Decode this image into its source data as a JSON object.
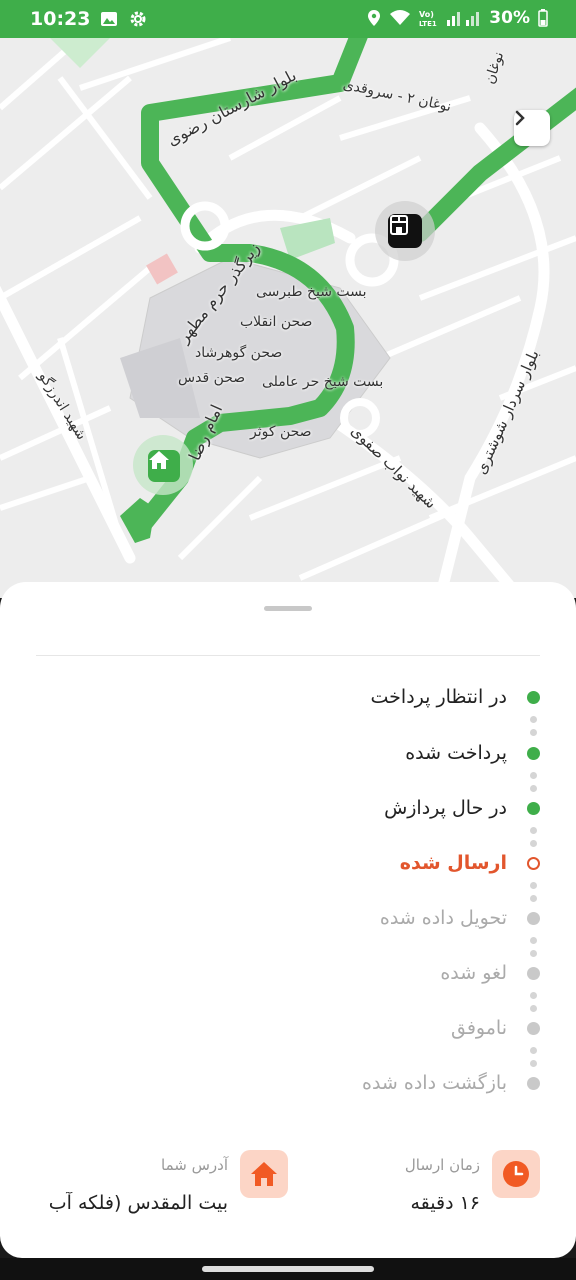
{
  "status_bar": {
    "time": "10:23",
    "battery": "30%",
    "icons": [
      "image-icon",
      "settings-icon",
      "location-icon",
      "wifi-icon",
      "volte-icon",
      "signal-icon",
      "battery-icon"
    ]
  },
  "map": {
    "labels": {
      "boulevard_sharestan": "بلوار شارستان رضوی",
      "noghan_sarvghadi": "نوغان ۲ - سروقدی",
      "noghan": "نوغان",
      "zirgozar": "زیرگذر حرم مطهر",
      "bast_tabarsi": "بست شیخ طبرسی",
      "sahn_enghelab": "صحن انقلاب",
      "sahn_goharshad": "صحن گوهرشاد",
      "sahn_ghods": "صحن قدس",
      "bast_horr": "بست شیخ حر عاملی",
      "sahn_kowsar": "صحن کوثر",
      "imam_reza": "امام رضا",
      "shahid_andarzgoo": "شهید اندرزگو",
      "navvab_safavi": "شهید نواب صفوی",
      "sardar_shooshtari": "بلوار سردار شوشتری"
    },
    "route_color": "#4cb557",
    "markers": [
      "home-marker-icon",
      "store-marker-icon"
    ]
  },
  "sheet": {
    "steps": [
      {
        "label": "در انتظار پرداخت",
        "state": "done"
      },
      {
        "label": "پرداخت شده",
        "state": "done"
      },
      {
        "label": "در حال پردازش",
        "state": "done"
      },
      {
        "label": "ارسال شده",
        "state": "current"
      },
      {
        "label": "تحویل داده شده",
        "state": "pending"
      },
      {
        "label": "لغو شده",
        "state": "pending"
      },
      {
        "label": "ناموفق",
        "state": "pending"
      },
      {
        "label": "بازگشت داده شده",
        "state": "pending"
      }
    ],
    "send_time": {
      "label": "زمان ارسال",
      "value": "۱۶ دقیقه"
    },
    "address": {
      "label": "آدرس شما",
      "value": "بیت المقدس (فلکه آب"
    },
    "colors": {
      "done": "#3fae4a",
      "current": "#e2562d",
      "pending": "#c9c9c9",
      "icon_bg": "#fcd5c6"
    }
  }
}
